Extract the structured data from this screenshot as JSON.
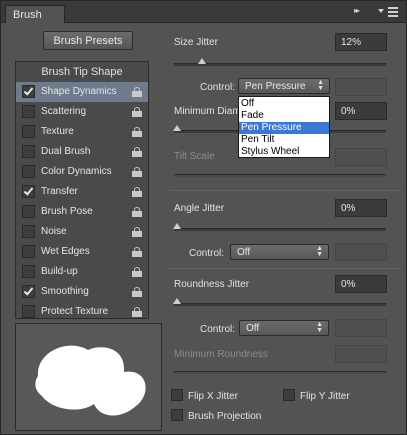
{
  "panel": {
    "tab_label": "Brush"
  },
  "header": {
    "collapse_glyph": "▸▸",
    "menu_icon": "panel-menu-icon"
  },
  "left": {
    "presets_button": "Brush Presets",
    "tip_shape_label": "Brush Tip Shape",
    "options": [
      {
        "label": "Shape Dynamics",
        "checked": true,
        "selected": true
      },
      {
        "label": "Scattering",
        "checked": false,
        "selected": false
      },
      {
        "label": "Texture",
        "checked": false,
        "selected": false
      },
      {
        "label": "Dual Brush",
        "checked": false,
        "selected": false
      },
      {
        "label": "Color Dynamics",
        "checked": false,
        "selected": false
      },
      {
        "label": "Transfer",
        "checked": true,
        "selected": false
      },
      {
        "label": "Brush Pose",
        "checked": false,
        "selected": false
      },
      {
        "label": "Noise",
        "checked": false,
        "selected": false
      },
      {
        "label": "Wet Edges",
        "checked": false,
        "selected": false
      },
      {
        "label": "Build-up",
        "checked": false,
        "selected": false
      },
      {
        "label": "Smoothing",
        "checked": true,
        "selected": false
      },
      {
        "label": "Protect Texture",
        "checked": false,
        "selected": false
      }
    ]
  },
  "size_jitter": {
    "label": "Size Jitter",
    "value": "12%",
    "slider_fraction": 0.12
  },
  "control1": {
    "label": "Control:",
    "value": "Pen Pressure"
  },
  "min_diameter": {
    "label": "Minimum Diam",
    "value": "0%"
  },
  "tilt_scale": {
    "label": "Tilt Scale"
  },
  "dropdown": {
    "options": [
      "Off",
      "Fade",
      "Pen Pressure",
      "Pen Tilt",
      "Stylus Wheel"
    ],
    "highlighted": "Pen Pressure"
  },
  "angle_jitter": {
    "label": "Angle Jitter",
    "value": "0%",
    "slider_fraction": 0
  },
  "control2": {
    "label": "Control:",
    "value": "Off"
  },
  "roundness_jitter": {
    "label": "Roundness Jitter",
    "value": "0%",
    "slider_fraction": 0
  },
  "control3": {
    "label": "Control:",
    "value": "Off"
  },
  "min_roundness": {
    "label": "Minimum Roundness"
  },
  "checkboxes": {
    "flip_x": "Flip X Jitter",
    "flip_y": "Flip Y Jitter",
    "projection": "Brush Projection"
  },
  "colors": {
    "panel_bg": "#535353",
    "selected_row": "#6d7b8d",
    "dropdown_highlight": "#3a78d4"
  }
}
